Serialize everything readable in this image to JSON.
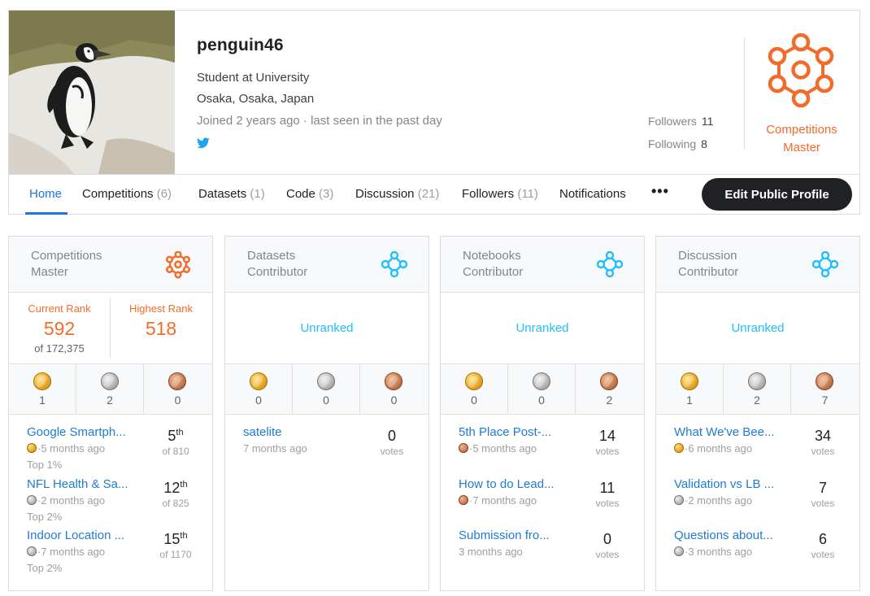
{
  "profile": {
    "username": "penguin46",
    "occupation": "Student at University",
    "location": "Osaka, Osaka, Japan",
    "joined": "Joined 2 years ago · last seen in the past day",
    "followers_label": "Followers",
    "followers_count": "11",
    "following_label": "Following",
    "following_count": "8",
    "tier_line1": "Competitions",
    "tier_line2": "Master",
    "social_icon": "twitter-icon"
  },
  "colors": {
    "master_orange": "#f36b2b",
    "contributor_blue": "#20beff",
    "link_blue": "#1e7bd4",
    "active_tab": "#1a73e8"
  },
  "nav": {
    "tabs": [
      {
        "label": "Home",
        "count": ""
      },
      {
        "label": "Competitions",
        "count": "(6)"
      },
      {
        "label": "Datasets",
        "count": "(1)"
      },
      {
        "label": "Code",
        "count": "(3)"
      },
      {
        "label": "Discussion",
        "count": "(21)"
      },
      {
        "label": "Followers",
        "count": "(11)"
      },
      {
        "label": "Notifications",
        "count": ""
      }
    ],
    "more": "•••",
    "edit_button": "Edit Public Profile"
  },
  "cards": [
    {
      "title_line1": "Competitions",
      "title_line2": "Master",
      "current_rank_label": "Current Rank",
      "current_rank": "592",
      "current_of": "of 172,375",
      "highest_rank_label": "Highest Rank",
      "highest_rank": "518",
      "medals": [
        "1",
        "2",
        "0"
      ],
      "items": [
        {
          "title": "Google Smartph...",
          "medal": "gold",
          "ago": "·5 months ago",
          "sub2": "Top 1%",
          "rank_num": "5",
          "rank_sup": "th",
          "rank_of": "of 810"
        },
        {
          "title": "NFL Health & Sa...",
          "medal": "silver",
          "ago": "·2 months ago",
          "sub2": "Top 2%",
          "rank_num": "12",
          "rank_sup": "th",
          "rank_of": "of 825"
        },
        {
          "title": "Indoor Location ...",
          "medal": "silver",
          "ago": "·7 months ago",
          "sub2": "Top 2%",
          "rank_num": "15",
          "rank_sup": "th",
          "rank_of": "of 1170"
        }
      ]
    },
    {
      "title_line1": "Datasets",
      "title_line2": "Contributor",
      "unranked": "Unranked",
      "medals": [
        "0",
        "0",
        "0"
      ],
      "items": [
        {
          "title": "satelite",
          "ago": "7 months ago",
          "votes": "0",
          "votes_label": "votes"
        }
      ]
    },
    {
      "title_line1": "Notebooks",
      "title_line2": "Contributor",
      "unranked": "Unranked",
      "medals": [
        "0",
        "0",
        "2"
      ],
      "items": [
        {
          "title": "5th Place Post-...",
          "medal": "bronze",
          "ago": "·5 months ago",
          "votes": "14",
          "votes_label": "votes"
        },
        {
          "title": "How to do Lead...",
          "medal": "bronze",
          "ago": "·7 months ago",
          "votes": "11",
          "votes_label": "votes"
        },
        {
          "title": "Submission fro...",
          "ago": "3 months ago",
          "votes": "0",
          "votes_label": "votes"
        }
      ]
    },
    {
      "title_line1": "Discussion",
      "title_line2": "Contributor",
      "unranked": "Unranked",
      "medals": [
        "1",
        "2",
        "7"
      ],
      "items": [
        {
          "title": "What We've Bee...",
          "medal": "gold",
          "ago": "·6 months ago",
          "votes": "34",
          "votes_label": "votes"
        },
        {
          "title": "Validation vs LB ...",
          "medal": "silver",
          "ago": "·2 months ago",
          "votes": "7",
          "votes_label": "votes"
        },
        {
          "title": "Questions about...",
          "medal": "silver",
          "ago": "·3 months ago",
          "votes": "6",
          "votes_label": "votes"
        }
      ]
    }
  ]
}
